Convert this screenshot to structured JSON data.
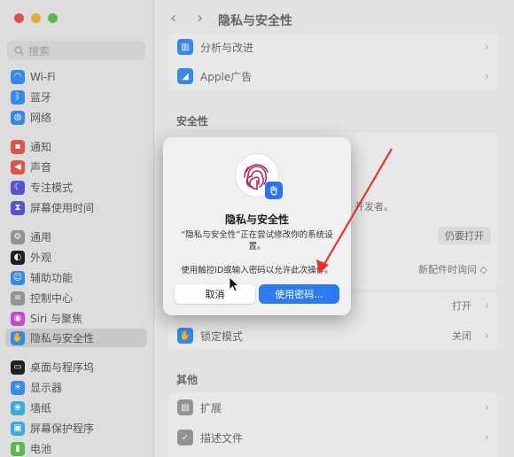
{
  "sidebar": {
    "search_placeholder": "搜索",
    "items": [
      {
        "label": "Wi-Fi",
        "icon": "wifi-icon",
        "color": "#3b8ef0"
      },
      {
        "label": "蓝牙",
        "icon": "bluetooth-icon",
        "color": "#3b8ef0"
      },
      {
        "label": "网络",
        "icon": "globe-icon",
        "color": "#3b8ef0"
      },
      {
        "label": "通知",
        "icon": "bell-icon",
        "color": "#e5574b"
      },
      {
        "label": "声音",
        "icon": "speaker-icon",
        "color": "#e5574b"
      },
      {
        "label": "专注模式",
        "icon": "moon-icon",
        "color": "#5a57d6"
      },
      {
        "label": "屏幕使用时间",
        "icon": "hourglass-icon",
        "color": "#5a57d6"
      },
      {
        "label": "通用",
        "icon": "gear-icon",
        "color": "#9a9a9a"
      },
      {
        "label": "外观",
        "icon": "appearance-icon",
        "color": "#222222"
      },
      {
        "label": "辅助功能",
        "icon": "accessibility-icon",
        "color": "#3b8ef0"
      },
      {
        "label": "控制中心",
        "icon": "control-center-icon",
        "color": "#9a9a9a"
      },
      {
        "label": "Siri 与聚焦",
        "icon": "siri-icon",
        "color": "#c94fd8"
      },
      {
        "label": "隐私与安全性",
        "icon": "hand-icon",
        "color": "#3b8ef0"
      },
      {
        "label": "桌面与程序坞",
        "icon": "dock-icon",
        "color": "#222222"
      },
      {
        "label": "显示器",
        "icon": "display-icon",
        "color": "#3b8ef0"
      },
      {
        "label": "墙纸",
        "icon": "wallpaper-icon",
        "color": "#3fb0e6"
      },
      {
        "label": "屏幕保护程序",
        "icon": "screensaver-icon",
        "color": "#3fb0e6"
      },
      {
        "label": "电池",
        "icon": "battery-icon",
        "color": "#5ac451"
      }
    ]
  },
  "header": {
    "title": "隐私与安全性",
    "back": "‹",
    "forward": "›"
  },
  "main": {
    "rows_top": [
      {
        "label": "分析与改进",
        "icon": "chart-icon",
        "color": "#3b8ef0"
      },
      {
        "label": "Apple广告",
        "icon": "megaphone-icon",
        "color": "#3b8ef0"
      }
    ],
    "security_title": "安全性",
    "developer_fragment": "开发者。",
    "open_anyway": "仍要打开",
    "new_accessory": "新配件时询问 ◇",
    "filevault_status": "打开",
    "lockdown_label": "锁定模式",
    "lockdown_status": "关闭",
    "other_title": "其他",
    "rows_other": [
      {
        "label": "扩展",
        "icon": "extension-icon",
        "color": "#9a9a9a"
      },
      {
        "label": "描述文件",
        "icon": "profile-icon",
        "color": "#9a9a9a"
      }
    ]
  },
  "dialog": {
    "title": "隐私与安全性",
    "message": "“隐私与安全性”正在尝试修改你的系统设置。",
    "message2": "使用触控ID或输入密码以允许此次操作。",
    "cancel_label": "取消",
    "ok_label": "使用密码..."
  },
  "colors": {
    "accent": "#2e7bf0",
    "annotation_arrow": "#e8322a"
  }
}
